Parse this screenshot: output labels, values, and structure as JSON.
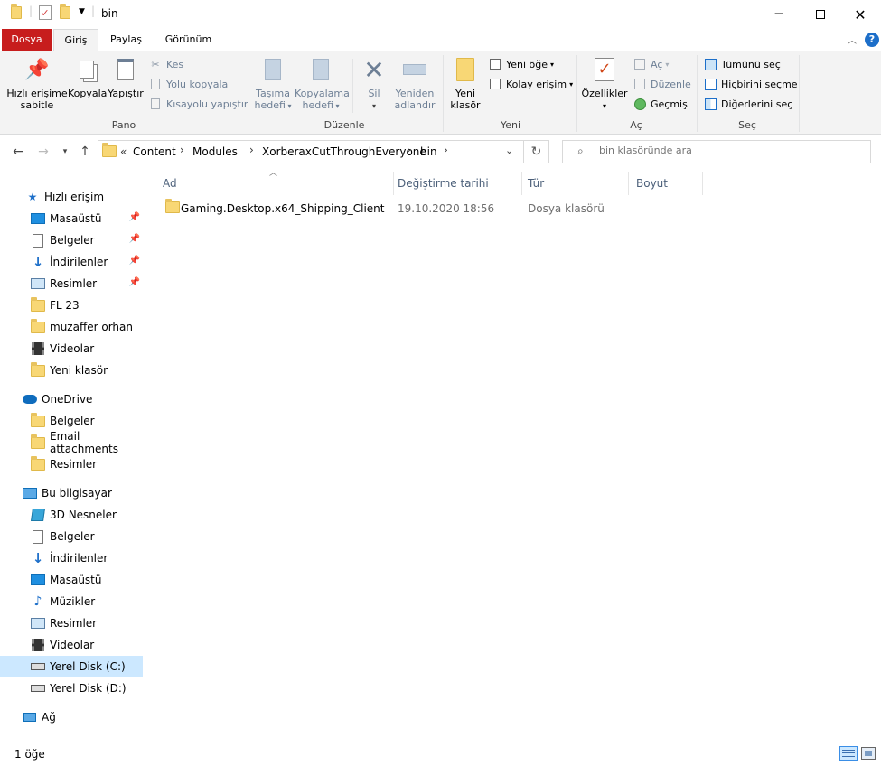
{
  "window": {
    "title": "bin",
    "minimize_icon": "minimize-icon",
    "maximize_icon": "maximize-icon",
    "close_icon": "close-icon"
  },
  "tabs": {
    "file": "Dosya",
    "home": "Giriş",
    "share": "Paylaş",
    "view": "Görünüm"
  },
  "ribbon": {
    "pano": {
      "label": "Pano",
      "pin": "Hızlı erişime sabitle",
      "pin_line1": "Hızlı erişime",
      "pin_line2": "sabitle",
      "copy": "Kopyala",
      "paste": "Yapıştır",
      "cut": "Kes",
      "copy_path": "Yolu kopyala",
      "paste_shortcut": "Kısayolu yapıştır"
    },
    "duzenle": {
      "label": "Düzenle",
      "move_line1": "Taşıma",
      "move_line2": "hedefi",
      "copyto_line1": "Kopyalama",
      "copyto_line2": "hedefi",
      "delete": "Sil",
      "rename_line1": "Yeniden",
      "rename_line2": "adlandır"
    },
    "yeni": {
      "label": "Yeni",
      "newfolder_line1": "Yeni",
      "newfolder_line2": "klasör",
      "new_item": "Yeni öğe",
      "easy_access": "Kolay erişim"
    },
    "ac": {
      "label": "Aç",
      "properties": "Özellikler",
      "open": "Aç",
      "edit": "Düzenle",
      "history": "Geçmiş"
    },
    "sec": {
      "label": "Seç",
      "select_all": "Tümünü seç",
      "select_none": "Hiçbirini seçme",
      "invert": "Diğerlerini seç"
    }
  },
  "address": {
    "overflow": "«",
    "crumbs": [
      "Content",
      "Modules",
      "XorberaxCutThroughEveryone",
      "bin"
    ],
    "search_placeholder": "bin klasöründe ara"
  },
  "navpane": {
    "quick_access": "Hızlı erişim",
    "quick_items": [
      "Masaüstü",
      "Belgeler",
      "İndirilenler",
      "Resimler",
      "FL 23",
      "muzaffer orhan",
      "Videolar",
      "Yeni klasör"
    ],
    "onedrive": "OneDrive",
    "onedrive_items": [
      "Belgeler",
      "Email attachments",
      "Resimler"
    ],
    "this_pc": "Bu bilgisayar",
    "pc_items": [
      "3D Nesneler",
      "Belgeler",
      "İndirilenler",
      "Masaüstü",
      "Müzikler",
      "Resimler",
      "Videolar",
      "Yerel Disk (C:)",
      "Yerel Disk (D:)"
    ],
    "network": "Ağ"
  },
  "columns": {
    "name": "Ad",
    "modified": "Değiştirme tarihi",
    "type": "Tür",
    "size": "Boyut"
  },
  "files": [
    {
      "name": "Gaming.Desktop.x64_Shipping_Client",
      "modified": "19.10.2020 18:56",
      "type": "Dosya klasörü",
      "size": ""
    }
  ],
  "status": {
    "count": "1 öğe"
  },
  "colors": {
    "file_tab": "#c71d1d",
    "selection": "#cce8ff",
    "accent": "#1d6fc9"
  }
}
